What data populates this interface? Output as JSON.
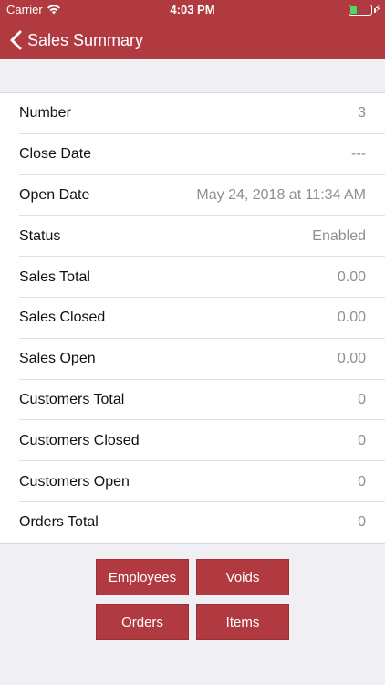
{
  "status_bar": {
    "carrier": "Carrier",
    "time": "4:03 PM",
    "battery_color": "#4cd964"
  },
  "nav": {
    "title": "Sales Summary",
    "back_icon": "chevron-left-icon",
    "bar_color": "#b03a40"
  },
  "rows": [
    {
      "label": "Number",
      "value": "3"
    },
    {
      "label": "Close Date",
      "value": "---"
    },
    {
      "label": "Open Date",
      "value": "May 24, 2018 at 11:34 AM"
    },
    {
      "label": "Status",
      "value": "Enabled"
    },
    {
      "label": "Sales Total",
      "value": "0.00"
    },
    {
      "label": "Sales Closed",
      "value": "0.00"
    },
    {
      "label": "Sales Open",
      "value": "0.00"
    },
    {
      "label": "Customers Total",
      "value": "0"
    },
    {
      "label": "Customers Closed",
      "value": "0"
    },
    {
      "label": "Customers Open",
      "value": "0"
    },
    {
      "label": "Orders Total",
      "value": "0"
    }
  ],
  "buttons": {
    "employees": "Employees",
    "voids": "Voids",
    "orders": "Orders",
    "items": "Items"
  }
}
